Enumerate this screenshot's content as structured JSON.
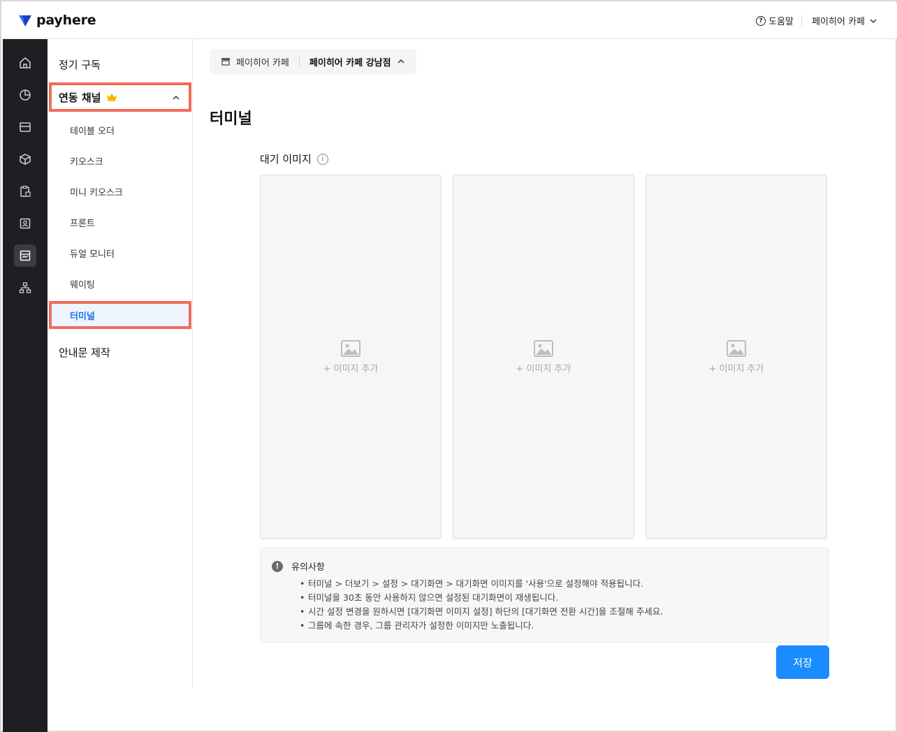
{
  "header": {
    "logo_text": "payhere",
    "help_label": "도움말",
    "store_label": "페이히어 카페"
  },
  "rail": {
    "icons": [
      "home-icon",
      "chart-pie-icon",
      "card-icon",
      "box-icon",
      "clipboard-icon",
      "contact-icon",
      "storefront-icon",
      "org-chart-icon"
    ],
    "active_index": 6
  },
  "sidebar": {
    "subscription": "정기 구독",
    "group_label": "연동 채널",
    "items": [
      "테이블 오더",
      "키오스크",
      "미니 키오스크",
      "프론트",
      "듀얼 모니터",
      "웨이팅"
    ],
    "active_item": "터미널",
    "notice_make": "안내문 제작"
  },
  "store_selector": {
    "store_name": "페이히어 카페",
    "branch_name": "페이히어 카페 강남점"
  },
  "page_title": "터미널",
  "standby": {
    "label": "대기 이미지",
    "slots": [
      "+ 이미지 추가",
      "+ 이미지 추가",
      "+ 이미지 추가"
    ]
  },
  "notice": {
    "title": "유의사항",
    "items": [
      "터미널 > 더보기 > 설정 > 대기화면 > 대기화면 이미지를 '사용'으로 설정해야 적용됩니다.",
      "터미널을 30초 동안 사용하지 않으면 설정된 대기화면이 재생됩니다.",
      "시간 설정 변경을 원하시면 [대기화면 이미지 설정] 하단의 [대기화면 전환 시간]을 조절해 주세요.",
      "그룹에 속한 경우, 그룹 관리자가 설정한 이미지만 노출됩니다."
    ]
  },
  "save_label": "저장",
  "colors": {
    "accent": "#1a8cff",
    "highlight": "#f26b5b",
    "rail_bg": "#1e1f23",
    "crown": "#f5b700"
  }
}
